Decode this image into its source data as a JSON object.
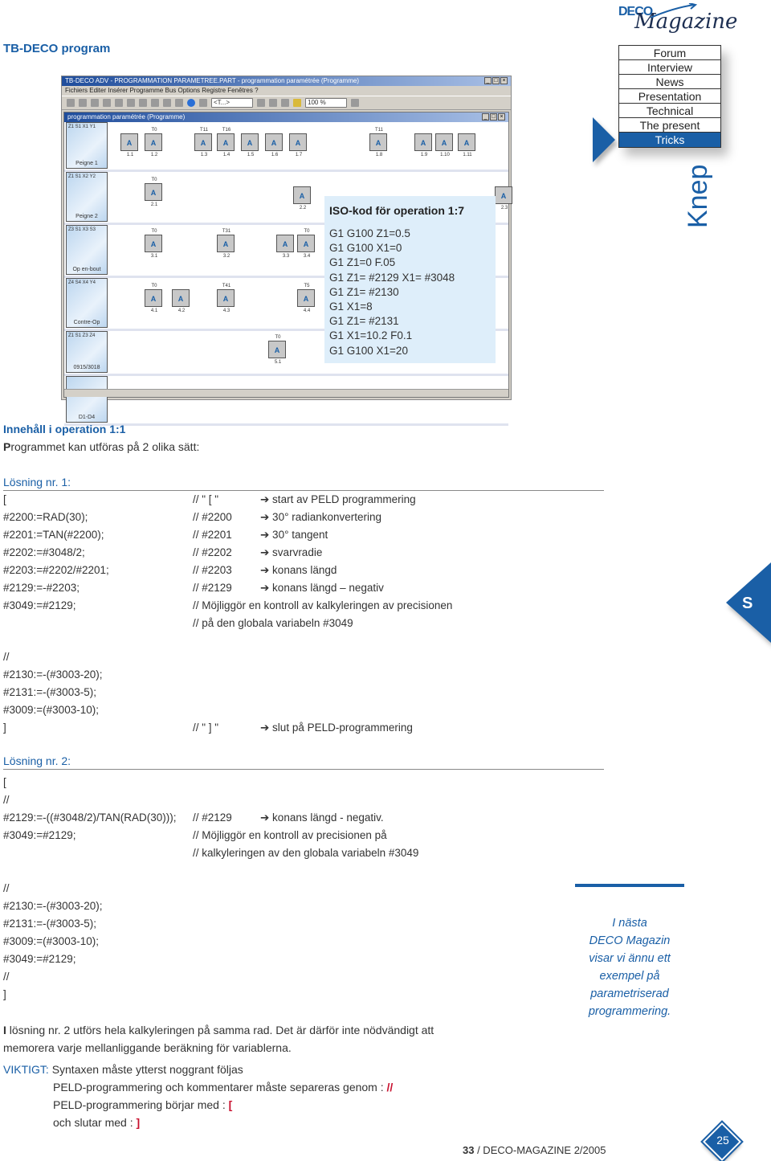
{
  "header": {
    "title": "TB-DECO program",
    "logo_deco": "DECO",
    "logo_magazine": "Magazine",
    "section_label": "Knep"
  },
  "nav": {
    "items": [
      {
        "label": "Forum",
        "active": false
      },
      {
        "label": "Interview",
        "active": false
      },
      {
        "label": "News",
        "active": false
      },
      {
        "label": "Presentation",
        "active": false
      },
      {
        "label": "Technical",
        "active": false
      },
      {
        "label": "The present",
        "active": false
      },
      {
        "label": "Tricks",
        "active": true
      }
    ]
  },
  "screenshot": {
    "window_title": "TB-DECO ADV - PROGRAMMATION PARAMETREE.PART - programmation paramétrée (Programme)",
    "menu": "Fichiers  Editer  Insérer  Programme  Bus  Options  Registre  Fenêtres  ?",
    "combo1": "<T...>",
    "combo2": "100 %",
    "inner_title": "programmation paramétrée (Programme)",
    "lanes": [
      {
        "label": "Peigne 1",
        "axes": "Z1 S1 X1 Y1"
      },
      {
        "label": "Peigne 2",
        "axes": "Z1 S1 X2 Y2"
      },
      {
        "label": "Op en-bout",
        "axes": "Z3 S1 X3 S3"
      },
      {
        "label": "Contre-Op",
        "axes": "Z4 S4 X4 Y4"
      },
      {
        "label": "0915/3018",
        "axes": "Z1 S1 Z3 Z4"
      },
      {
        "label": "D1-D4",
        "axes": ""
      }
    ],
    "ops": [
      {
        "id": "1.1",
        "tool": ""
      },
      {
        "id": "1.2",
        "tool": "T0"
      },
      {
        "id": "1.3",
        "tool": "T11"
      },
      {
        "id": "1.4",
        "tool": "T16"
      },
      {
        "id": "1.5",
        "tool": ""
      },
      {
        "id": "1.6",
        "tool": ""
      },
      {
        "id": "1.7",
        "tool": ""
      },
      {
        "id": "1.8",
        "tool": "T11"
      },
      {
        "id": "1.9",
        "tool": ""
      },
      {
        "id": "1.10",
        "tool": ""
      },
      {
        "id": "1.11",
        "tool": ""
      },
      {
        "id": "2.1",
        "tool": "T0"
      },
      {
        "id": "2.2",
        "tool": ""
      },
      {
        "id": "2.3",
        "tool": ""
      },
      {
        "id": "3.1",
        "tool": "T0"
      },
      {
        "id": "3.2",
        "tool": "T31"
      },
      {
        "id": "3.3",
        "tool": ""
      },
      {
        "id": "3.4",
        "tool": "T0"
      },
      {
        "id": "4.1",
        "tool": "T0"
      },
      {
        "id": "4.2",
        "tool": ""
      },
      {
        "id": "4.3",
        "tool": "T41"
      },
      {
        "id": "4.4",
        "tool": "T5"
      },
      {
        "id": "5.1",
        "tool": "T0"
      }
    ]
  },
  "popup": {
    "title": "ISO-kod för operation 1:7",
    "lines": [
      "G1 G100 Z1=0.5",
      "G1 G100 X1=0",
      "G1 Z1=0 F.05",
      "G1 Z1= #2129 X1= #3048",
      "G1 Z1= #2130",
      "G1 X1=8",
      "G1 Z1= #2131",
      "G1 X1=10.2 F0.1",
      "G1 G100 X1=20"
    ]
  },
  "intro": {
    "heading": "Innehåll i operation 1:1",
    "text_first": "P",
    "text_rest": "rogrammet kan utföras på 2 olika sätt:"
  },
  "solution1": {
    "heading": "Lösning nr. 1:",
    "rows": [
      {
        "code": "[",
        "comment": "// \" [ \"",
        "desc": "➔ start av PELD programmering"
      },
      {
        "code": "#2200:=RAD(30);",
        "comment": "// #2200",
        "desc": "➔ 30° radiankonvertering"
      },
      {
        "code": "#2201:=TAN(#2200);",
        "comment": "// #2201",
        "desc": "➔ 30° tangent"
      },
      {
        "code": "#2202:=#3048/2;",
        "comment": "// #2202",
        "desc": "➔ svarvradie"
      },
      {
        "code": "#2203:=#2202/#2201;",
        "comment": "// #2203",
        "desc": "➔ konans längd"
      },
      {
        "code": "#2129:=-#2203;",
        "comment": "// #2129",
        "desc": "➔ konans längd – negativ"
      },
      {
        "code": "#3049:=#2129;",
        "comment": "// Möjliggör en kontroll av kalkyleringen av precisionen",
        "desc": ""
      },
      {
        "code": "",
        "comment": "// på den globala variabeln #3049",
        "desc": ""
      }
    ],
    "rows2": [
      {
        "code": "//",
        "comment": "",
        "desc": ""
      },
      {
        "code": "#2130:=-(#3003-20);",
        "comment": "",
        "desc": ""
      },
      {
        "code": "#2131:=-(#3003-5);",
        "comment": "",
        "desc": ""
      },
      {
        "code": "#3009:=(#3003-10);",
        "comment": "",
        "desc": ""
      },
      {
        "code": "]",
        "comment": "// \" ] \"",
        "desc": "➔ slut på PELD-programmering"
      }
    ]
  },
  "solution2": {
    "heading": "Lösning nr. 2:",
    "rows": [
      {
        "code": "[",
        "comment": "",
        "desc": ""
      },
      {
        "code": "//",
        "comment": "",
        "desc": ""
      },
      {
        "code": "#2129:=-((#3048/2)/TAN(RAD(30)));",
        "comment": "// #2129",
        "desc": "➔ konans längd - negativ."
      },
      {
        "code": "#3049:=#2129;",
        "comment": "// Möjliggör en kontroll av precisionen på",
        "desc": ""
      },
      {
        "code": "",
        "comment": "// kalkyleringen av den globala variabeln #3049",
        "desc": ""
      }
    ],
    "rows2": [
      {
        "code": "//"
      },
      {
        "code": "#2130:=-(#3003-20);"
      },
      {
        "code": "#2131:=-(#3003-5);"
      },
      {
        "code": "#3009:=(#3003-10);"
      },
      {
        "code": "#3049:=#2129;"
      },
      {
        "code": "//"
      },
      {
        "code": "]"
      }
    ]
  },
  "note": {
    "first": "I",
    "line1": " lösning nr. 2 utförs hela kalkyleringen på samma rad. Det är därför inte nödvändigt att",
    "line2": "memorera varje mellanliggande beräkning för variablerna."
  },
  "important": {
    "label": "VIKTIGT:",
    "line1": "Syntaxen måste ytterst noggrant följas",
    "line2": "PELD-programmering och kommentarer måste separeras genom : ",
    "line2_sym": "//",
    "line3": "PELD-programmering börjar med : ",
    "line3_sym": "[",
    "line4": "och slutar med : ",
    "line4_sym": "]"
  },
  "callout": {
    "lines": [
      "I nästa",
      "DECO Magazin",
      "visar vi ännu ett",
      "exempel på",
      "parametriserad",
      "programmering."
    ]
  },
  "side_tab": {
    "letter": "S"
  },
  "footer": {
    "page_number_bold": "33",
    "publication": " / DECO-MAGAZINE 2/2005",
    "badge_number": "25"
  },
  "colors": {
    "accent": "#1a5fa6",
    "highlight_red": "#c8102e",
    "popup_bg": "#deeefa"
  }
}
